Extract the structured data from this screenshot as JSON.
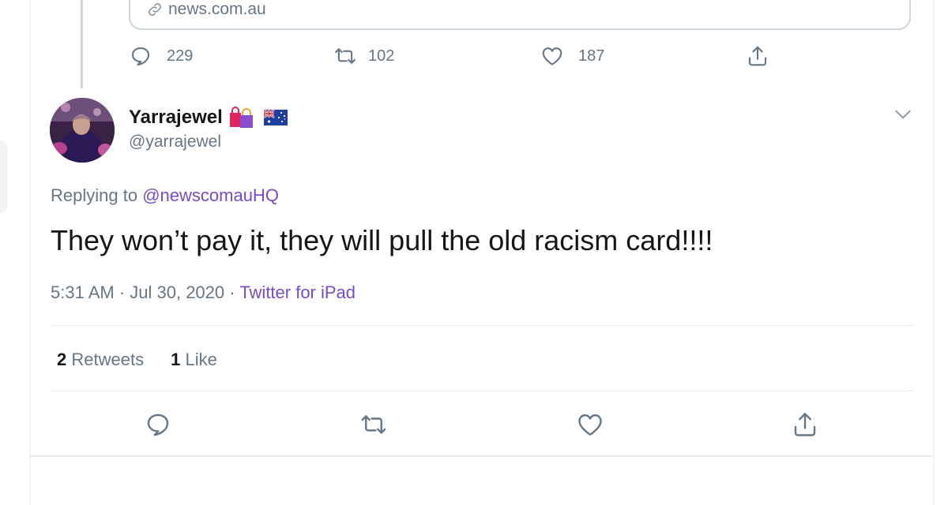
{
  "quoted_tweet": {
    "link_domain": "news.com.au",
    "actions": {
      "replies": "229",
      "retweets": "102",
      "likes": "187"
    }
  },
  "tweet": {
    "display_name": "Yarrajewel",
    "handle": "@yarrajewel",
    "replying_prefix": "Replying to",
    "replying_to": "@newscomauHQ",
    "text": "They won’t pay it, they will pull the old racism card!!!!",
    "timestamp": "5:31 AM · Jul 30, 2020",
    "separator": "·",
    "source": "Twitter for iPad",
    "stats": {
      "retweets_count": "2",
      "retweets_label": "Retweets",
      "likes_count": "1",
      "likes_label": "Like"
    },
    "name_emojis": [
      "shopping-bags-emoji",
      "australia-flag-emoji"
    ]
  },
  "colors": {
    "accent": "#794bc4",
    "secondary_text": "#657786",
    "primary_text": "#14171a",
    "border": "#e6ecf0"
  },
  "icons": {
    "reply": "reply-icon",
    "retweet": "retweet-icon",
    "like": "heart-icon",
    "share": "share-icon",
    "link": "link-icon",
    "more": "chevron-down-icon"
  }
}
